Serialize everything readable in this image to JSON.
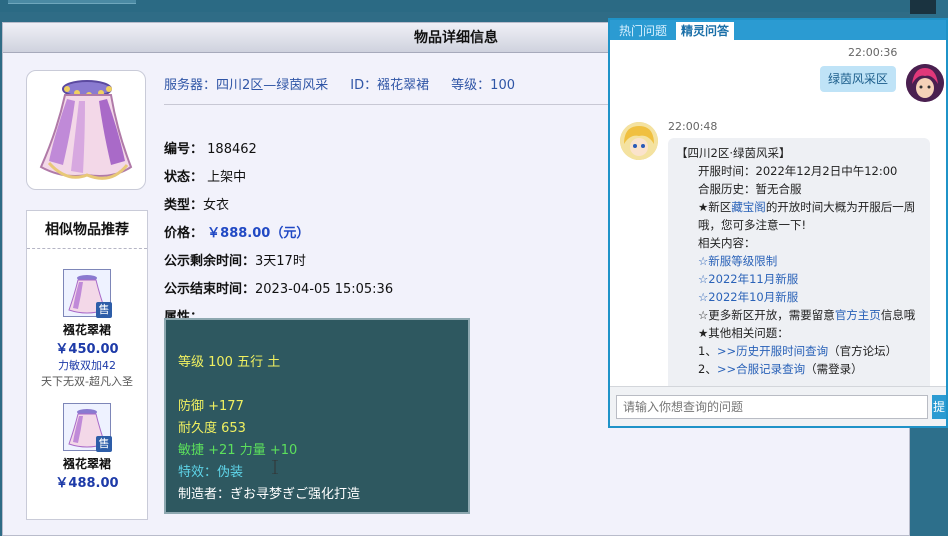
{
  "page": {
    "header_title": "物品详细信息"
  },
  "item": {
    "server_label": "服务器：四川2区—绿茵风采",
    "id_label": "ID：",
    "id_value": "襁花翠裙",
    "level_label": "等级：",
    "level_value": "100",
    "number_key": "编号：",
    "number_value": "188462",
    "status_key": "状态：",
    "status_value": "上架中",
    "type_key": "类型：",
    "type_value": "女衣",
    "price_key": "价格：",
    "price_value": "￥888.00（元）",
    "remain_key": "公示剩余时间：",
    "remain_value": "3天17时",
    "end_key": "公示结束时间：",
    "end_value": "2023-04-05 15:05:36",
    "attr_key": "属性："
  },
  "attributes": {
    "level_line": "等级 100 五行 土",
    "defense": "防御 +177",
    "durability": "耐久度 653",
    "agility": "敏捷 +21 力量 +10",
    "effect": "特效：伪装",
    "maker": "制造者：ぎお寻梦ぎご强化打造"
  },
  "similar": {
    "title": "相似物品推荐",
    "sale_badge": "售",
    "items": [
      {
        "name": "襁花翠裙",
        "price": "￥450.00",
        "attr": "力敏双加42",
        "desc": "天下无双-超凡入圣"
      },
      {
        "name": "襁花翠裙",
        "price": "￥488.00"
      }
    ]
  },
  "chat": {
    "tabs": [
      "热门问题",
      "精灵问答"
    ],
    "user_time": "22:00:36",
    "user_msg": "绿茵风采区",
    "bot_time": "22:00:48",
    "bot_lines": {
      "l1": "【四川2区·绿茵风采】",
      "l2": "开服时间：2022年12月2日中午12:00",
      "l3": "合服历史：暂无合服",
      "l4a": "★新区",
      "l4link": "藏宝阁",
      "l4b": "的开放时间大概为开服后一周哦，您可多注意一下!",
      "l5": "相关内容：",
      "l6": "☆新服等级限制",
      "l7": "☆2022年11月新服",
      "l8": "☆2022年10月新服",
      "l9a": "☆更多新区开放，需要留意",
      "l9link": "官方主页",
      "l9b": "信息哦",
      "l10": "★其他相关问题：",
      "l11a": "1、",
      "l11link": ">>历史开服时间查询",
      "l11b": "（官方论坛）",
      "l12a": "2、",
      "l12link": ">>合服记录查询",
      "l12b": "（需登录）"
    },
    "input_placeholder": "请输入你想查询的问题",
    "send_label": "提"
  }
}
